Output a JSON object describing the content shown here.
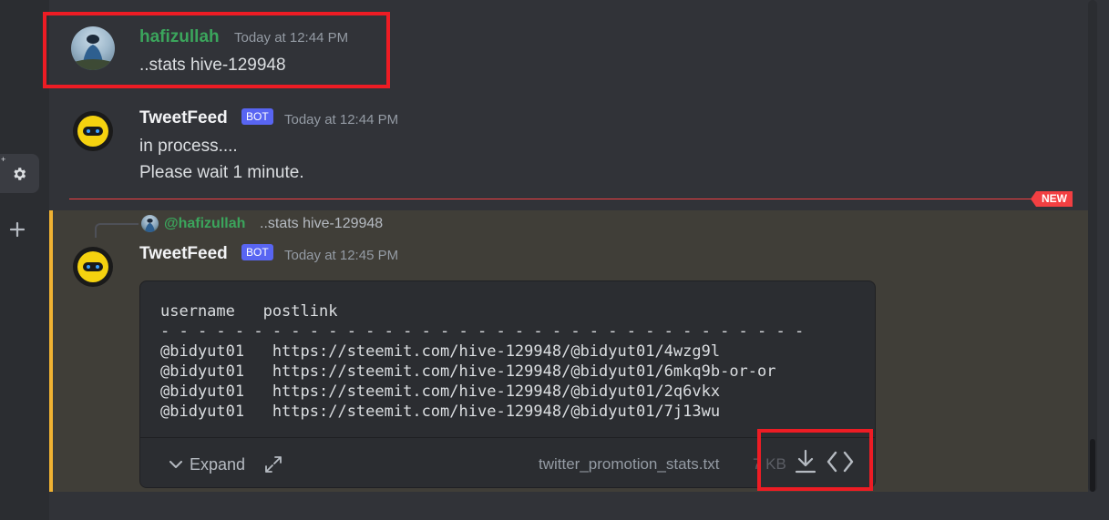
{
  "messages": [
    {
      "author": "hafizullah",
      "author_color": "#3ba55c",
      "timestamp": "Today at 12:44 PM",
      "lines": [
        "..stats hive-129948"
      ]
    },
    {
      "author": "TweetFeed",
      "badge": "BOT",
      "timestamp": "Today at 12:44 PM",
      "lines": [
        "in process....",
        "Please wait 1 minute."
      ]
    }
  ],
  "divider": {
    "label": "NEW",
    "color": "#f23f42"
  },
  "reply_message": {
    "reply_to": {
      "author": "@hafizullah",
      "preview": "..stats hive-129948"
    },
    "author": "TweetFeed",
    "badge": "BOT",
    "timestamp": "Today at 12:45 PM",
    "code": {
      "header": "username   postlink",
      "separator": "- - - - - - - - - - - - - - - - - - - - - - - - - - - - - - - - - - -",
      "rows": [
        "@bidyut01   https://steemit.com/hive-129948/@bidyut01/4wzg9l",
        "@bidyut01   https://steemit.com/hive-129948/@bidyut01/6mkq9b-or-or",
        "@bidyut01   https://steemit.com/hive-129948/@bidyut01/2q6vkx",
        "@bidyut01   https://steemit.com/hive-129948/@bidyut01/7j13wu"
      ]
    },
    "attachment": {
      "expand_label": "Expand",
      "filename": "twitter_promotion_stats.txt",
      "filesize": "7 KB"
    }
  },
  "colors": {
    "background": "#313338",
    "mention_highlight": "#403e38",
    "mention_bar": "#f0b232",
    "annotation_red": "#ed1c24",
    "bot_badge": "#5865f2"
  }
}
